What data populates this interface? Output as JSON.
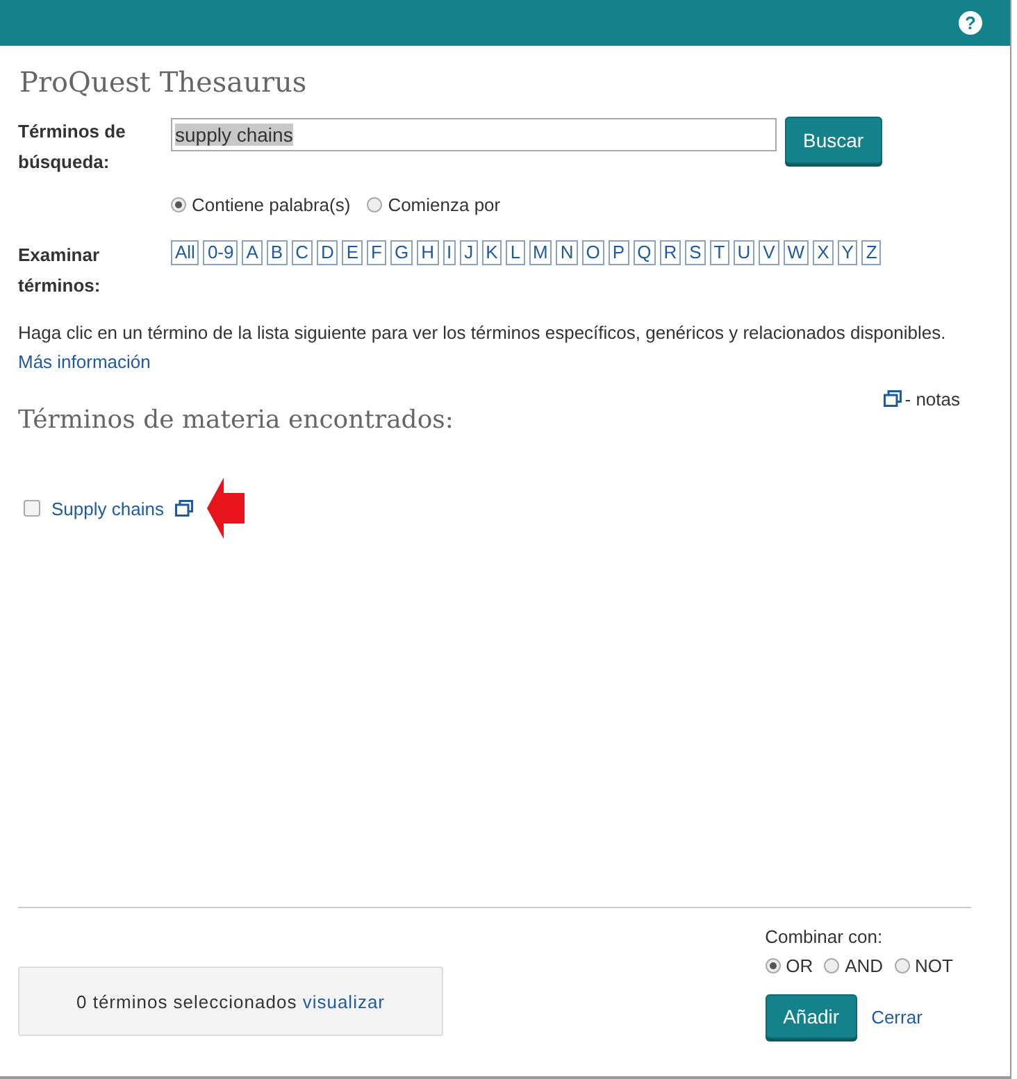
{
  "header": {
    "help_icon": "?"
  },
  "title": "ProQuest Thesaurus",
  "search": {
    "label": "Términos de búsqueda:",
    "value": "supply chains",
    "button": "Buscar"
  },
  "match_options": [
    {
      "label": "Contiene palabra(s)",
      "selected": true
    },
    {
      "label": "Comienza por",
      "selected": false
    }
  ],
  "browse": {
    "label": "Examinar términos:",
    "letters": [
      "All",
      "0-9",
      "A",
      "B",
      "C",
      "D",
      "E",
      "F",
      "G",
      "H",
      "I",
      "J",
      "K",
      "L",
      "M",
      "N",
      "O",
      "P",
      "Q",
      "R",
      "S",
      "T",
      "U",
      "V",
      "W",
      "X",
      "Y",
      "Z"
    ]
  },
  "info": {
    "text": "Haga clic en un término de la lista siguiente para ver los términos específicos, genéricos y relacionados disponibles.",
    "link": "Más información"
  },
  "results": {
    "heading": "Términos de materia encontrados:",
    "notes_legend": "- notas",
    "terms": [
      {
        "label": "Supply chains",
        "checked": false
      }
    ]
  },
  "selection": {
    "count": "0",
    "text": "términos seleccionados",
    "link": "visualizar"
  },
  "combine": {
    "label": "Combinar con:",
    "options": [
      {
        "label": "OR",
        "selected": true
      },
      {
        "label": "AND",
        "selected": false
      },
      {
        "label": "NOT",
        "selected": false
      }
    ]
  },
  "buttons": {
    "add": "Añadir",
    "close": "Cerrar"
  }
}
